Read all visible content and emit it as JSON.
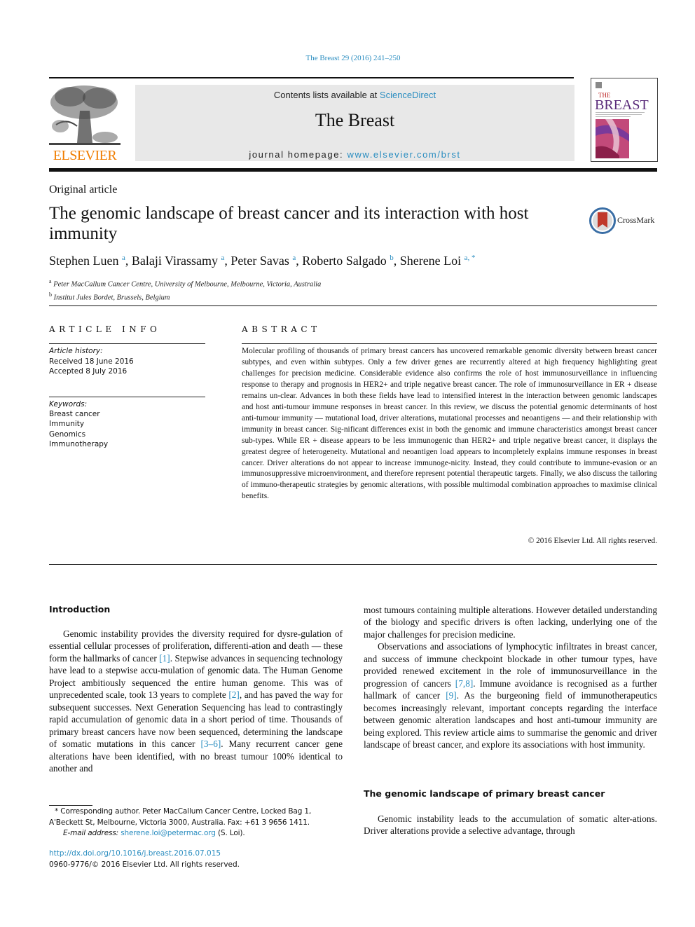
{
  "header": {
    "citation": "The Breast 29 (2016) 241–250",
    "publisher_logo_text": "ELSEVIER",
    "contents_prefix": "Contents lists available at ",
    "contents_link": "ScienceDirect",
    "journal_name": "The Breast",
    "homepage_prefix": "journal homepage: ",
    "homepage_link": "www.elsevier.com/brst",
    "cover_title_small": "THE",
    "cover_title_large": "BREAST"
  },
  "article": {
    "type": "Original article",
    "title": "The genomic landscape of breast cancer and its interaction with host immunity",
    "crossmark_label": "CrossMark",
    "authors": [
      {
        "name": "Stephen Luen",
        "affil": "a"
      },
      {
        "name": "Balaji Virassamy",
        "affil": "a"
      },
      {
        "name": "Peter Savas",
        "affil": "a"
      },
      {
        "name": "Roberto Salgado",
        "affil": "b"
      },
      {
        "name": "Sherene Loi",
        "affil": "a, *"
      }
    ],
    "affiliations": [
      {
        "key": "a",
        "text": "Peter MacCallum Cancer Centre, University of Melbourne, Melbourne, Victoria, Australia"
      },
      {
        "key": "b",
        "text": "Institut Jules Bordet, Brussels, Belgium"
      }
    ]
  },
  "article_info": {
    "heading": "ARTICLE INFO",
    "history_label": "Article history:",
    "received": "Received 18 June 2016",
    "accepted": "Accepted 8 July 2016",
    "keywords_label": "Keywords:",
    "keywords": [
      "Breast cancer",
      "Immunity",
      "Genomics",
      "Immunotherapy"
    ]
  },
  "abstract": {
    "heading": "ABSTRACT",
    "text": "Molecular profiling of thousands of primary breast cancers has uncovered remarkable genomic diversity between breast cancer subtypes, and even within subtypes. Only a few driver genes are recurrently altered at high frequency highlighting great challenges for precision medicine. Considerable evidence also confirms the role of host immunosurveillance in influencing response to therapy and prognosis in HER2+ and triple negative breast cancer. The role of immunosurveillance in ER + disease remains un-clear. Advances in both these fields have lead to intensified interest in the interaction between genomic landscapes and host anti-tumour immune responses in breast cancer. In this review, we discuss the potential genomic determinants of host anti-tumour immunity — mutational load, driver alterations, mutational processes and neoantigens — and their relationship with immunity in breast cancer. Sig-nificant differences exist in both the genomic and immune characteristics amongst breast cancer sub-types. While ER + disease appears to be less immunogenic than HER2+ and triple negative breast cancer, it displays the greatest degree of heterogeneity. Mutational and neoantigen load appears to incompletely explains immune responses in breast cancer. Driver alterations do not appear to increase immunoge-nicity. Instead, they could contribute to immune-evasion or an immunosuppressive microenvironment, and therefore represent potential therapeutic targets. Finally, we also discuss the tailoring of immuno-therapeutic strategies by genomic alterations, with possible multimodal combination approaches to maximise clinical benefits.",
    "copyright": "© 2016 Elsevier Ltd. All rights reserved."
  },
  "body": {
    "intro_heading": "Introduction",
    "intro_p1": [
      {
        "t": "Genomic instability provides the diversity required for dysre-gulation of essential cellular processes of proliferation, differenti-ation and death — these form the hallmarks of cancer "
      },
      {
        "ref": "[1]"
      },
      {
        "t": ". Stepwise advances in sequencing technology have lead to a stepwise accu-mulation of genomic data. The Human Genome Project ambitiously sequenced the entire human genome. This was of unprecedented scale, took 13 years to complete "
      },
      {
        "ref": "[2]"
      },
      {
        "t": ", and has paved the way for subsequent successes. Next Generation Sequencing has lead to contrastingly rapid accumulation of genomic data in a short period of time. Thousands of primary breast cancers have now been sequenced, determining the landscape of somatic mutations in this cancer "
      },
      {
        "ref": "[3–6]"
      },
      {
        "t": ". Many recurrent cancer gene alterations have been identified, with no breast tumour 100% identical to another and"
      }
    ],
    "right_p1": "most tumours containing multiple alterations. However detailed understanding of the biology and specific drivers is often lacking, underlying one of the major challenges for precision medicine.",
    "right_p2": [
      {
        "t": "Observations and associations of lymphocytic infiltrates in breast cancer, and success of immune checkpoint blockade in other tumour types, have provided renewed excitement in the role of immunosurveillance in the progression of cancers "
      },
      {
        "ref": "[7,8]"
      },
      {
        "t": ". Immune avoidance is recognised as a further hallmark of cancer "
      },
      {
        "ref": "[9]"
      },
      {
        "t": ". As the burgeoning field of immunotherapeutics becomes increasingly relevant, important concepts regarding the interface between genomic alteration landscapes and host anti-tumour immunity are being explored. This review article aims to summarise the genomic and driver landscape of breast cancer, and explore its associations with host immunity."
      }
    ],
    "section2_heading": "The genomic landscape of primary breast cancer",
    "section2_p1": "Genomic instability leads to the accumulation of somatic alter-ations. Driver alterations provide a selective advantage, through"
  },
  "footnotes": {
    "corresponding": "* Corresponding author. Peter MacCallum Cancer Centre, Locked Bag 1, A'Beckett St, Melbourne, Victoria 3000, Australia. Fax: +61 3 9656 1411.",
    "email_label": "E-mail address: ",
    "email": "sherene.loi@petermac.org",
    "email_suffix": " (S. Loi).",
    "doi": "http://dx.doi.org/10.1016/j.breast.2016.07.015",
    "issn_copyright": "0960-9776/© 2016 Elsevier Ltd. All rights reserved."
  },
  "colors": {
    "link": "#2a8dc0",
    "elsevier_orange": "#f07d00",
    "banner_gray": "#e8e8e8"
  }
}
